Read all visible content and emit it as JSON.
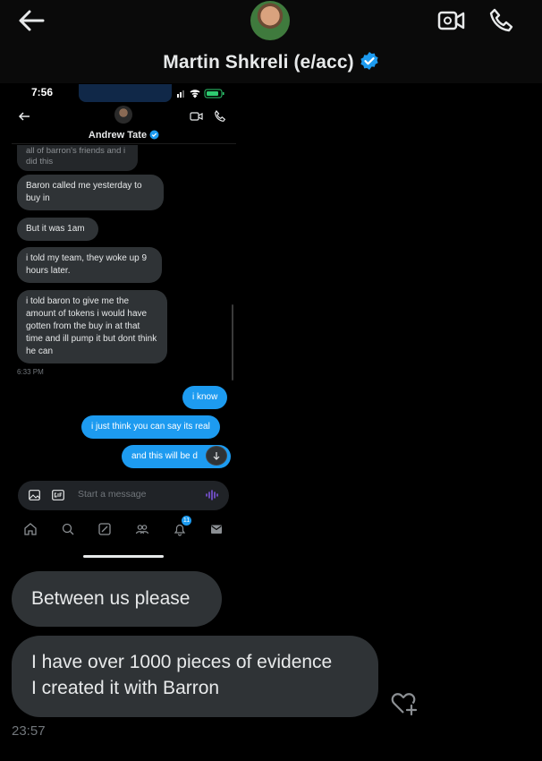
{
  "header": {
    "title": "Martin Shkreli (e/acc)",
    "icons": {
      "back": "back-arrow-icon",
      "video": "video-call-icon",
      "call": "phone-icon",
      "verified": "verified-badge-icon"
    }
  },
  "screenshot": {
    "status_time": "7:56",
    "contact_name": "Andrew Tate",
    "messages": [
      {
        "side": "incoming",
        "text": "all of barron's friends and i did this"
      },
      {
        "side": "incoming",
        "text": "Baron called me yesterday to buy in"
      },
      {
        "side": "incoming",
        "text": "But it was 1am"
      },
      {
        "side": "incoming",
        "text": "i told my team, they woke up 9 hours later."
      },
      {
        "side": "incoming",
        "text": "i told baron to give me the amount of tokens i would have gotten from the buy in at that time and ill pump it but dont think he can"
      },
      {
        "side": "outgoing",
        "text": "i know"
      },
      {
        "side": "outgoing",
        "text": "i just think you can say its real"
      },
      {
        "side": "outgoing",
        "text": "and this will be d"
      }
    ],
    "time_label": "6:33 PM",
    "composer_placeholder": "Start a message",
    "notification_count": "11",
    "colors": {
      "accent": "#1d9bf0",
      "incoming_bubble": "#2f3336",
      "background": "#000000"
    }
  },
  "messages": [
    {
      "side": "incoming",
      "text": "Between us please"
    },
    {
      "side": "incoming",
      "lines": [
        "I have over 1000 pieces of evidence",
        "I created it with Barron"
      ]
    }
  ],
  "timestamp": "23:57",
  "reaction_icon": "heart-plus-icon"
}
